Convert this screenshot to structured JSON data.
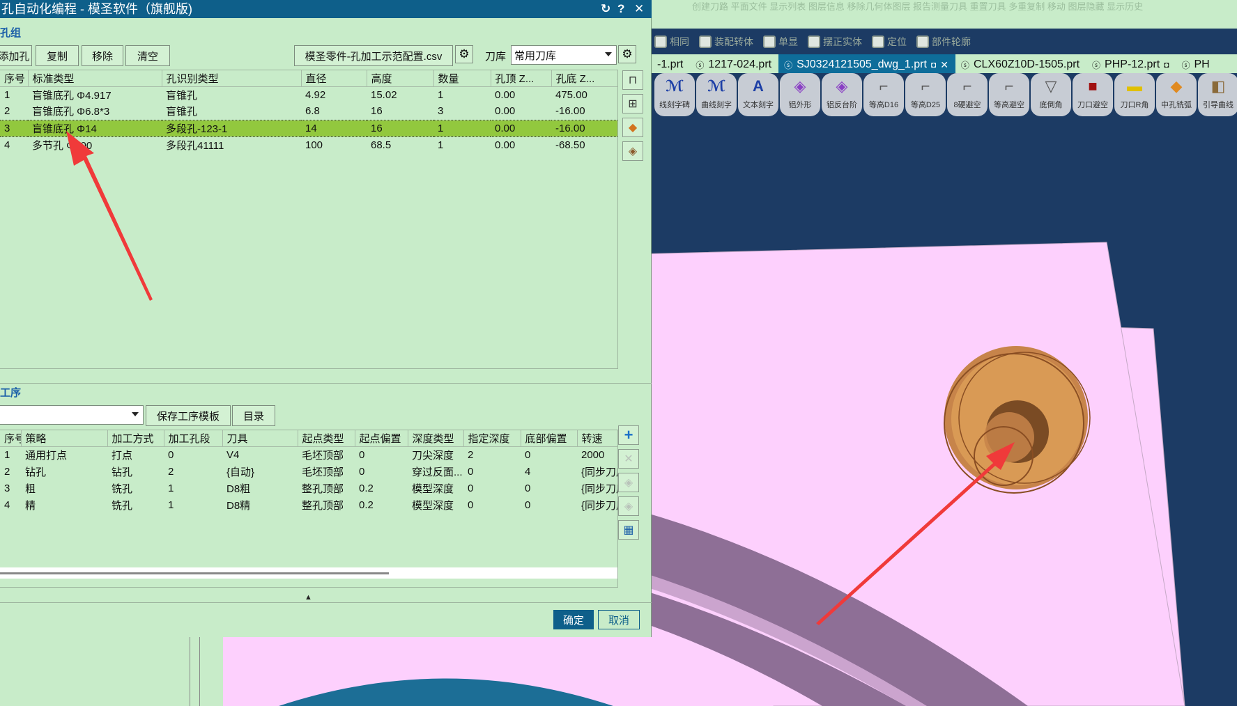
{
  "cad": {
    "ribbon_faded": "创建刀路   平面文件   显示列表   图层信息   移除几何体图层   报告测量刀具   重置刀具   多重复制   移动   图层隐藏   显示历史",
    "toolbar2": [
      "相同",
      "装配转体",
      "单显",
      "摆正实体",
      "定位",
      "部件轮廓"
    ],
    "tabs": [
      {
        "label": "-1.prt",
        "active": false
      },
      {
        "label": "1217-024.prt",
        "active": false
      },
      {
        "label": "SJ0324121505_dwg_1.prt",
        "active": true
      },
      {
        "label": "CLX60Z10D-1505.prt",
        "active": false
      },
      {
        "label": "PHP-12.prt",
        "active": false
      },
      {
        "label": "PH",
        "active": false
      }
    ],
    "icon_buttons": [
      {
        "label": "线刻字碑"
      },
      {
        "label": "曲线刻字"
      },
      {
        "label": "文本刻字"
      },
      {
        "label": "铝外形"
      },
      {
        "label": "铝反台阶"
      },
      {
        "label": "等高D16"
      },
      {
        "label": "等高D25"
      },
      {
        "label": "8硬避空"
      },
      {
        "label": "等高避空"
      },
      {
        "label": "底倒角"
      },
      {
        "label": "刀口避空"
      },
      {
        "label": "刀口R角"
      },
      {
        "label": "中孔铣弧"
      },
      {
        "label": "引导曲线"
      }
    ]
  },
  "dialog": {
    "title": "孔自动化编程 - 模圣软件（旗舰版)",
    "hole_group": {
      "section_title": "孔组",
      "buttons": {
        "add": "添加孔",
        "copy": "复制",
        "remove": "移除",
        "clear": "清空"
      },
      "config_file": "模圣零件-孔加工示范配置.csv",
      "tool_lib_label": "刀库",
      "tool_lib_value": "常用刀库",
      "columns": [
        "序号",
        "标准类型",
        "孔识别类型",
        "直径",
        "高度",
        "数量",
        "孔顶 Z...",
        "孔底 Z..."
      ],
      "rows": [
        [
          "1",
          "盲锥底孔 Φ4.917",
          "盲锥孔",
          "4.92",
          "15.02",
          "1",
          "0.00",
          "475.00"
        ],
        [
          "2",
          "盲锥底孔 Φ6.8*3",
          "盲锥孔",
          "6.8",
          "16",
          "3",
          "0.00",
          "-16.00"
        ],
        [
          "3",
          "盲锥底孔 Φ14",
          "多段孔-123-1",
          "14",
          "16",
          "1",
          "0.00",
          "-16.00"
        ],
        [
          "4",
          "多节孔 Φ100",
          "多段孔41111",
          "100",
          "68.5",
          "1",
          "0.00",
          "-68.50"
        ]
      ],
      "selected_row": 3
    },
    "process": {
      "section_title": "工序",
      "template_value": "",
      "buttons": {
        "save_template": "保存工序模板",
        "catalog": "目录"
      },
      "columns": [
        "序号",
        "策略",
        "加工方式",
        "加工孔段",
        "刀具",
        "起点类型",
        "起点偏置",
        "深度类型",
        "指定深度",
        "底部偏置",
        "转速"
      ],
      "rows": [
        [
          "1",
          "通用打点",
          "打点",
          "0",
          "V4",
          "毛坯顶部",
          "0",
          "刀尖深度",
          "2",
          "0",
          "2000"
        ],
        [
          "2",
          "钻孔",
          "钻孔",
          "2",
          "{自动}",
          "毛坯顶部",
          "0",
          "穿过反面...",
          "0",
          "4",
          "{同步刀库}"
        ],
        [
          "3",
          "粗",
          "铣孔",
          "1",
          "D8粗",
          "整孔顶部",
          "0.2",
          "模型深度",
          "0",
          "0",
          "{同步刀库}"
        ],
        [
          "4",
          "精",
          "铣孔",
          "1",
          "D8精",
          "整孔顶部",
          "0.2",
          "模型深度",
          "0",
          "0",
          "{同步刀库}"
        ]
      ]
    },
    "footer": {
      "ok": "确定",
      "cancel": "取消"
    }
  },
  "colors": {
    "dialog_bg": "#c8ecc9",
    "titlebar": "#0e5f8a",
    "selected_row": "#92c83e",
    "viewport_bg": "#1c3b64",
    "part_pink": "#fdd0fd",
    "ring_purple": "#8e6f96",
    "hole_orange": "#d99a55",
    "arrow_red": "#f03a3a"
  }
}
